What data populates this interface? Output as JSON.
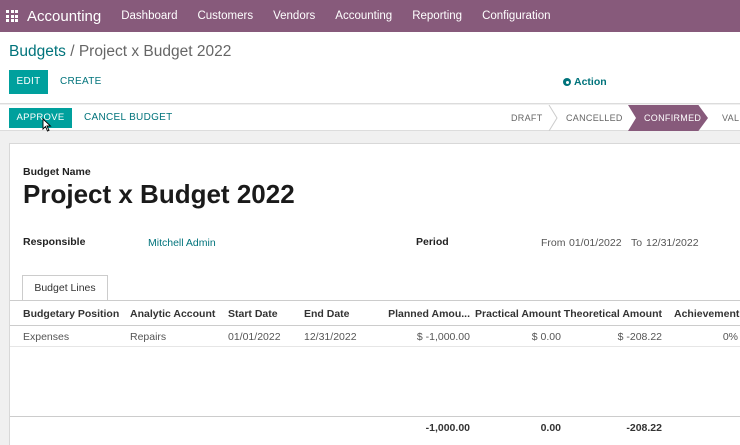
{
  "app": {
    "name": "Accounting"
  },
  "menu": [
    "Dashboard",
    "Customers",
    "Vendors",
    "Accounting",
    "Reporting",
    "Configuration"
  ],
  "breadcrumb": {
    "parent": "Budgets",
    "separator": " / ",
    "current": "Project x Budget 2022"
  },
  "toolbar": {
    "edit": "EDIT",
    "create": "CREATE",
    "action": "Action"
  },
  "statusbar": {
    "approve": "APPROVE",
    "cancel_budget": "CANCEL BUDGET",
    "stages": [
      "DRAFT",
      "CANCELLED",
      "CONFIRMED",
      "VAL"
    ],
    "active_stage": "CONFIRMED"
  },
  "form": {
    "name_label": "Budget Name",
    "name": "Project x Budget 2022",
    "responsible_label": "Responsible",
    "responsible": "Mitchell Admin",
    "period_label": "Period",
    "period_from_prefix": "From",
    "period_from": "01/01/2022",
    "period_to_prefix": "To",
    "period_to": "12/31/2022"
  },
  "tabs": [
    "Budget Lines"
  ],
  "table": {
    "columns": [
      "Budgetary Position",
      "Analytic Account",
      "Start Date",
      "End Date",
      "Planned Amou...",
      "Practical Amount",
      "Theoretical Amount",
      "Achievement"
    ],
    "rows": [
      [
        "Expenses",
        "Repairs",
        "01/01/2022",
        "12/31/2022",
        "$ -1,000.00",
        "$ 0.00",
        "$ -208.22",
        "0%"
      ]
    ],
    "totals": {
      "planned": "-1,000.00",
      "practical": "0.00",
      "theoretical": "-208.22"
    }
  },
  "colors": {
    "brand": "#875a7b",
    "primary": "#00a09d",
    "link": "#00737b"
  }
}
